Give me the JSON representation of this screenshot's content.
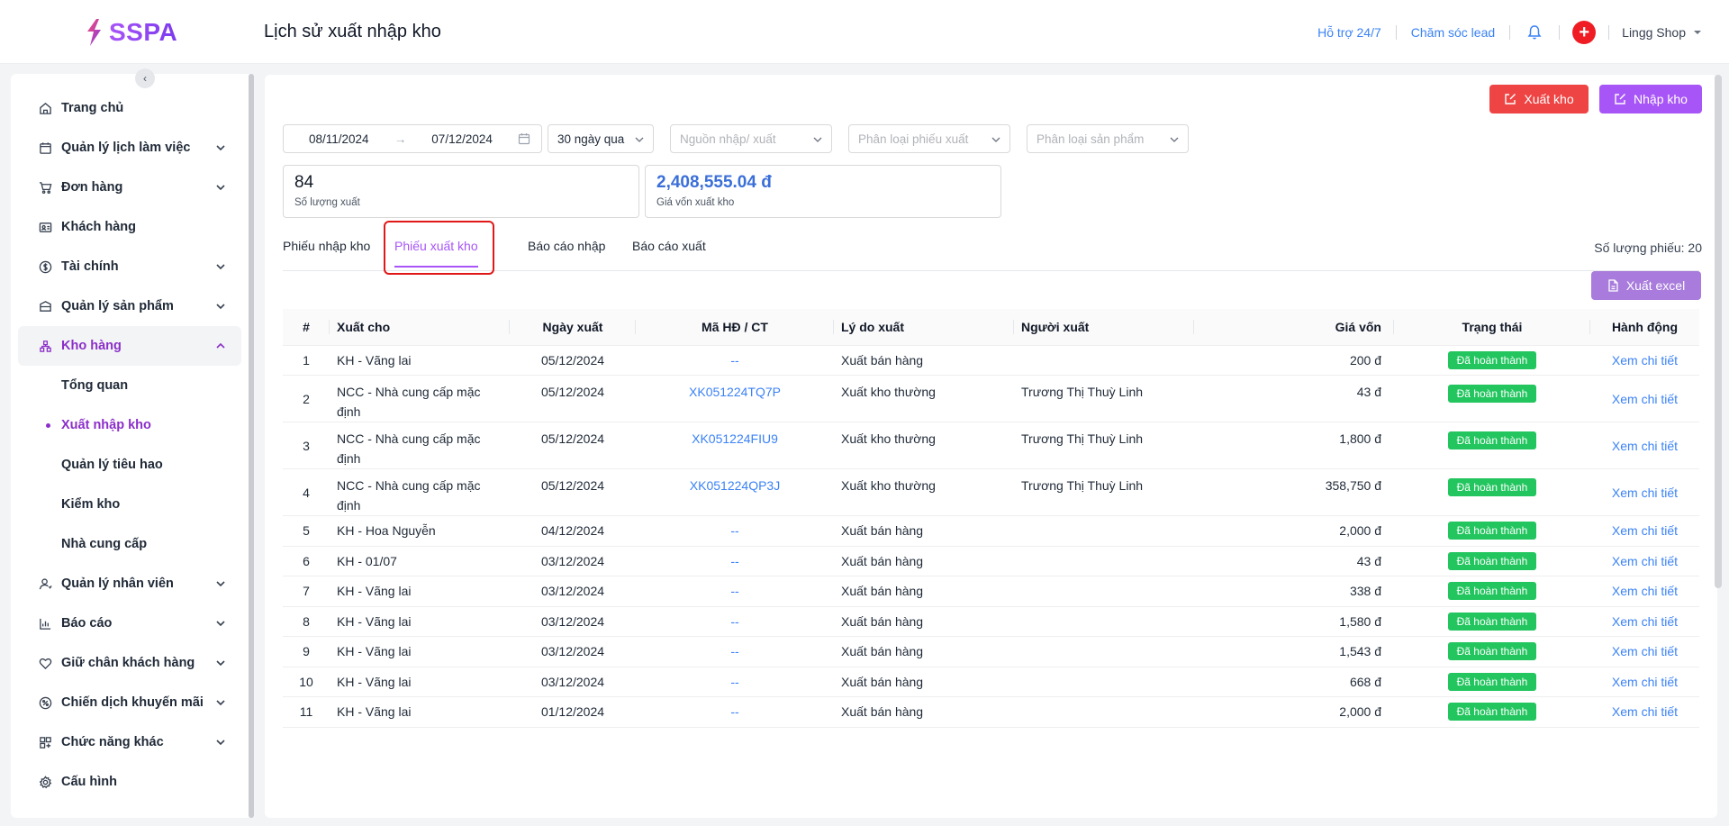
{
  "header": {
    "logo_text": "SSPA",
    "page_title": "Lịch sử xuất nhập kho",
    "support_link": "Hỗ trợ 24/7",
    "lead_link": "Chăm sóc lead",
    "shop_name": "Lingg Shop"
  },
  "sidebar": {
    "items": [
      {
        "label": "Trang chủ",
        "icon": "home-icon"
      },
      {
        "label": "Quản lý lịch làm việc",
        "icon": "calendar-icon"
      },
      {
        "label": "Đơn hàng",
        "icon": "cart-icon"
      },
      {
        "label": "Khách hàng",
        "icon": "customer-card-icon"
      },
      {
        "label": "Tài chính",
        "icon": "dollar-icon"
      },
      {
        "label": "Quản lý sản phẩm",
        "icon": "box-icon"
      },
      {
        "label": "Kho hàng",
        "icon": "warehouse-icon"
      },
      {
        "label": "Quản lý nhân viên",
        "icon": "staff-icon"
      },
      {
        "label": "Báo cáo",
        "icon": "chart-icon"
      },
      {
        "label": "Giữ chân khách hàng",
        "icon": "heart-icon"
      },
      {
        "label": "Chiến dịch khuyến mãi",
        "icon": "promo-icon"
      },
      {
        "label": "Chức năng khác",
        "icon": "grid-icon"
      },
      {
        "label": "Cấu hình",
        "icon": "settings-icon"
      }
    ],
    "sub_items": [
      "Tổng quan",
      "Xuất nhập kho",
      "Quản lý tiêu hao",
      "Kiểm kho",
      "Nhà cung cấp"
    ]
  },
  "actions": {
    "export_label": "Xuất kho",
    "import_label": "Nhập kho",
    "excel_label": "Xuất excel"
  },
  "filters": {
    "date_from": "08/11/2024",
    "date_to": "07/12/2024",
    "range": "30 ngày qua",
    "source_placeholder": "Nguồn nhập/ xuất",
    "slip_type_placeholder": "Phân loại phiếu xuất",
    "product_type_placeholder": "Phân loại sản phẩm"
  },
  "stats": {
    "quantity_value": "84",
    "quantity_label": "Số lượng xuất",
    "cost_value": "2,408,555.04 đ",
    "cost_label": "Giá vốn xuất kho"
  },
  "tabs": [
    "Phiếu nhập kho",
    "Phiếu xuất kho",
    "Báo cáo nhập",
    "Báo cáo xuất"
  ],
  "slip_count": "Số lượng phiếu: 20",
  "table": {
    "columns": [
      "#",
      "Xuất cho",
      "Ngày xuất",
      "Mã HĐ / CT",
      "Lý do xuất",
      "Người xuất",
      "Giá vốn",
      "Trạng thái",
      "Hành động"
    ],
    "rows": [
      {
        "idx": "1",
        "for": "KH - Vãng lai",
        "date": "05/12/2024",
        "code": "--",
        "reason": "Xuất bán hàng",
        "user": "",
        "cost": "200 đ",
        "status": "Đã hoàn thành",
        "action": "Xem chi tiết"
      },
      {
        "idx": "2",
        "for": "NCC - Nhà cung cấp mặc định",
        "date": "05/12/2024",
        "code": "XK051224TQ7P",
        "reason": "Xuất kho thường",
        "user": "Trương Thị Thuỳ Linh",
        "cost": "43 đ",
        "status": "Đã hoàn thành",
        "action": "Xem chi tiết"
      },
      {
        "idx": "3",
        "for": "NCC - Nhà cung cấp mặc định",
        "date": "05/12/2024",
        "code": "XK051224FIU9",
        "reason": "Xuất kho thường",
        "user": "Trương Thị Thuỳ Linh",
        "cost": "1,800 đ",
        "status": "Đã hoàn thành",
        "action": "Xem chi tiết"
      },
      {
        "idx": "4",
        "for": "NCC - Nhà cung cấp mặc định",
        "date": "05/12/2024",
        "code": "XK051224QP3J",
        "reason": "Xuất kho thường",
        "user": "Trương Thị Thuỳ Linh",
        "cost": "358,750 đ",
        "status": "Đã hoàn thành",
        "action": "Xem chi tiết"
      },
      {
        "idx": "5",
        "for": "KH - Hoa Nguyễn",
        "date": "04/12/2024",
        "code": "--",
        "reason": "Xuất bán hàng",
        "user": "",
        "cost": "2,000 đ",
        "status": "Đã hoàn thành",
        "action": "Xem chi tiết"
      },
      {
        "idx": "6",
        "for": "KH - 01/07",
        "date": "03/12/2024",
        "code": "--",
        "reason": "Xuất bán hàng",
        "user": "",
        "cost": "43 đ",
        "status": "Đã hoàn thành",
        "action": "Xem chi tiết"
      },
      {
        "idx": "7",
        "for": "KH - Vãng lai",
        "date": "03/12/2024",
        "code": "--",
        "reason": "Xuất bán hàng",
        "user": "",
        "cost": "338 đ",
        "status": "Đã hoàn thành",
        "action": "Xem chi tiết"
      },
      {
        "idx": "8",
        "for": "KH - Vãng lai",
        "date": "03/12/2024",
        "code": "--",
        "reason": "Xuất bán hàng",
        "user": "",
        "cost": "1,580 đ",
        "status": "Đã hoàn thành",
        "action": "Xem chi tiết"
      },
      {
        "idx": "9",
        "for": "KH - Vãng lai",
        "date": "03/12/2024",
        "code": "--",
        "reason": "Xuất bán hàng",
        "user": "",
        "cost": "1,543 đ",
        "status": "Đã hoàn thành",
        "action": "Xem chi tiết"
      },
      {
        "idx": "10",
        "for": "KH - Vãng lai",
        "date": "03/12/2024",
        "code": "--",
        "reason": "Xuất bán hàng",
        "user": "",
        "cost": "668 đ",
        "status": "Đã hoàn thành",
        "action": "Xem chi tiết"
      },
      {
        "idx": "11",
        "for": "KH - Vãng lai",
        "date": "01/12/2024",
        "code": "--",
        "reason": "Xuất bán hàng",
        "user": "",
        "cost": "2,000 đ",
        "status": "Đã hoàn thành",
        "action": "Xem chi tiết"
      }
    ]
  },
  "colors": {
    "accent": "#a855f7",
    "danger": "#ef4444",
    "success": "#22c55e",
    "link": "#3b82f6"
  }
}
